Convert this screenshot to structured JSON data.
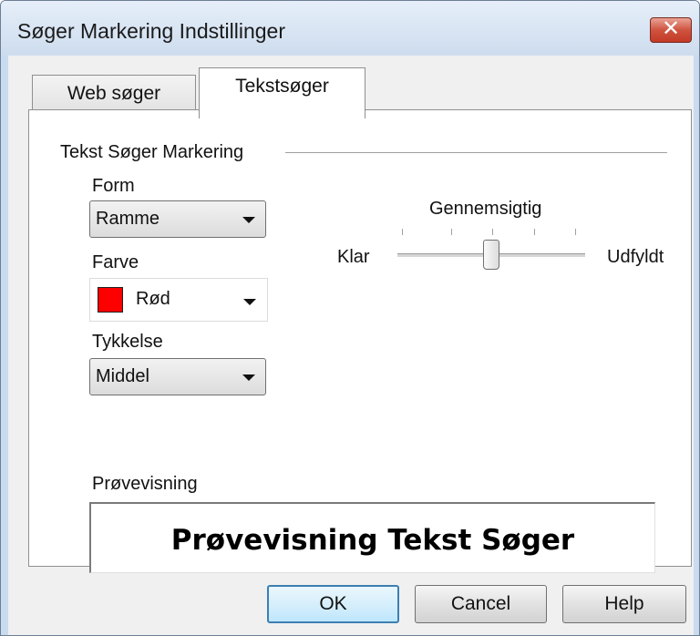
{
  "window": {
    "title": "Søger Markering Indstillinger",
    "close_glyph": "✕"
  },
  "tabs": [
    {
      "label": "Web søger"
    },
    {
      "label": "Tekstsøger"
    }
  ],
  "section": {
    "title": "Tekst Søger Markering"
  },
  "form": {
    "label": "Form",
    "value": "Ramme"
  },
  "color": {
    "label": "Farve",
    "value": "Rød",
    "swatch_color": "#ff0000"
  },
  "thickness": {
    "label": "Tykkelse",
    "value": "Middel"
  },
  "transparency": {
    "label": "Gennemsigtig",
    "min_label": "Klar",
    "max_label": "Udfyldt",
    "position_fraction": 0.5
  },
  "preview": {
    "label": "Prøvevisning",
    "text": "Prøvevisning Tekst Søger"
  },
  "buttons": {
    "ok": "OK",
    "cancel": "Cancel",
    "help": "Help"
  }
}
